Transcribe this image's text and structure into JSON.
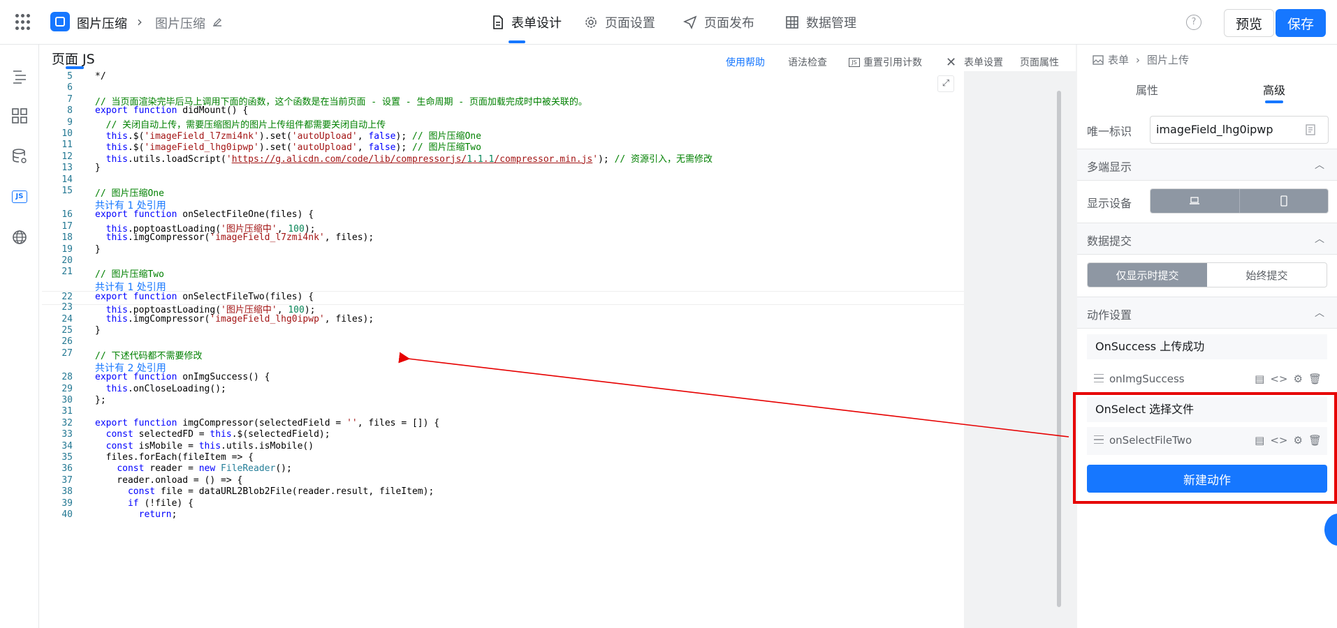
{
  "header": {
    "app_name": "图片压缩",
    "page_name": "图片压缩",
    "nav": [
      {
        "label": "表单设计",
        "icon": "document-icon"
      },
      {
        "label": "页面设置",
        "icon": "gear-icon"
      },
      {
        "label": "页面发布",
        "icon": "send-icon"
      },
      {
        "label": "数据管理",
        "icon": "table-icon"
      }
    ],
    "help": "?",
    "preview_label": "预览",
    "save_label": "保存"
  },
  "editor": {
    "title": "页面 JS",
    "links": {
      "help": "使用帮助",
      "lint": "语法检查",
      "reset": "重置引用计数",
      "form_settings": "表单设置",
      "page_props": "页面属性"
    },
    "lines": [
      {
        "n": "5",
        "text": "*/"
      },
      {
        "n": "6",
        "text": ""
      },
      {
        "n": "7",
        "text": "// 当页面渲染完毕后马上调用下面的函数，这个函数是在当前页面 - 设置 - 生命周期 - 页面加载完成时中被关联的。"
      },
      {
        "n": "8",
        "text": "export function didMount() {"
      },
      {
        "n": "9",
        "text": "  // 关闭自动上传，需要压缩图片的图片上传组件都需要关闭自动上传"
      },
      {
        "n": "10",
        "text": "  this.$('imageField_l7zmi4nk').set('autoUpload', false); // 图片压缩One"
      },
      {
        "n": "11",
        "text": "  this.$('imageField_lhg0ipwp').set('autoUpload', false); // 图片压缩Two"
      },
      {
        "n": "12",
        "text": "  this.utils.loadScript('https://g.alicdn.com/code/lib/compressorjs/1.1.1/compressor.min.js'); // 资源引入，无需修改"
      },
      {
        "n": "13",
        "text": "}"
      },
      {
        "n": "14",
        "text": ""
      },
      {
        "n": "15",
        "text": "// 图片压缩One"
      },
      {
        "lens": "共计有 1 处引用"
      },
      {
        "n": "16",
        "text": "export function onSelectFileOne(files) {"
      },
      {
        "n": "17",
        "text": "  this.poptoastLoading('图片压缩中', 100);"
      },
      {
        "n": "18",
        "text": "  this.imgCompressor('imageField_l7zmi4nk', files);"
      },
      {
        "n": "19",
        "text": "}"
      },
      {
        "n": "20",
        "text": ""
      },
      {
        "n": "21",
        "text": "// 图片压缩Two"
      },
      {
        "lens": "共计有 1 处引用"
      },
      {
        "n": "22",
        "text": "export function onSelectFileTwo(files) {"
      },
      {
        "n": "23",
        "text": "  this.poptoastLoading('图片压缩中', 100);"
      },
      {
        "n": "24",
        "text": "  this.imgCompressor('imageField_lhg0ipwp', files);"
      },
      {
        "n": "25",
        "text": "}"
      },
      {
        "n": "26",
        "text": ""
      },
      {
        "n": "27",
        "text": "// 下述代码都不需要修改"
      },
      {
        "lens": "共计有 2 处引用"
      },
      {
        "n": "28",
        "text": "export function onImgSuccess() {"
      },
      {
        "n": "29",
        "text": "  this.onCloseLoading();"
      },
      {
        "n": "30",
        "text": "};"
      },
      {
        "n": "31",
        "text": ""
      },
      {
        "n": "32",
        "text": "export function imgCompressor(selectedField = '', files = []) {"
      },
      {
        "n": "33",
        "text": "  const selectedFD = this.$(selectedField);"
      },
      {
        "n": "34",
        "text": "  const isMobile = this.utils.isMobile()"
      },
      {
        "n": "35",
        "text": "  files.forEach(fileItem => {"
      },
      {
        "n": "36",
        "text": "    const reader = new FileReader();"
      },
      {
        "n": "37",
        "text": "    reader.onload = () => {"
      },
      {
        "n": "38",
        "text": "      const file = dataURL2Blob2File(reader.result, fileItem);"
      },
      {
        "n": "39",
        "text": "      if (!file) {"
      },
      {
        "n": "40",
        "text": "        return;"
      }
    ]
  },
  "panel": {
    "breadcrumb": [
      "表单",
      "图片上传"
    ],
    "tabs": [
      "属性",
      "高级"
    ],
    "active_tab": "高级",
    "uid_label": "唯一标识",
    "uid_value": "imageField_lhg0ipwp",
    "multi_display": {
      "title": "多端显示",
      "device_label": "显示设备",
      "devices": [
        "laptop-icon",
        "mobile-icon"
      ]
    },
    "data_submit": {
      "title": "数据提交",
      "options": [
        "仅显示时提交",
        "始终提交"
      ],
      "selected": "仅显示时提交"
    },
    "actions": {
      "title": "动作设置",
      "groups": [
        {
          "label": "OnSuccess 上传成功",
          "handler": "onImgSuccess"
        },
        {
          "label": "OnSelect 选择文件",
          "handler": "onSelectFileTwo"
        }
      ],
      "new_label": "新建动作"
    }
  },
  "colors": {
    "accent": "#1677ff",
    "highlight": "#e60000"
  }
}
